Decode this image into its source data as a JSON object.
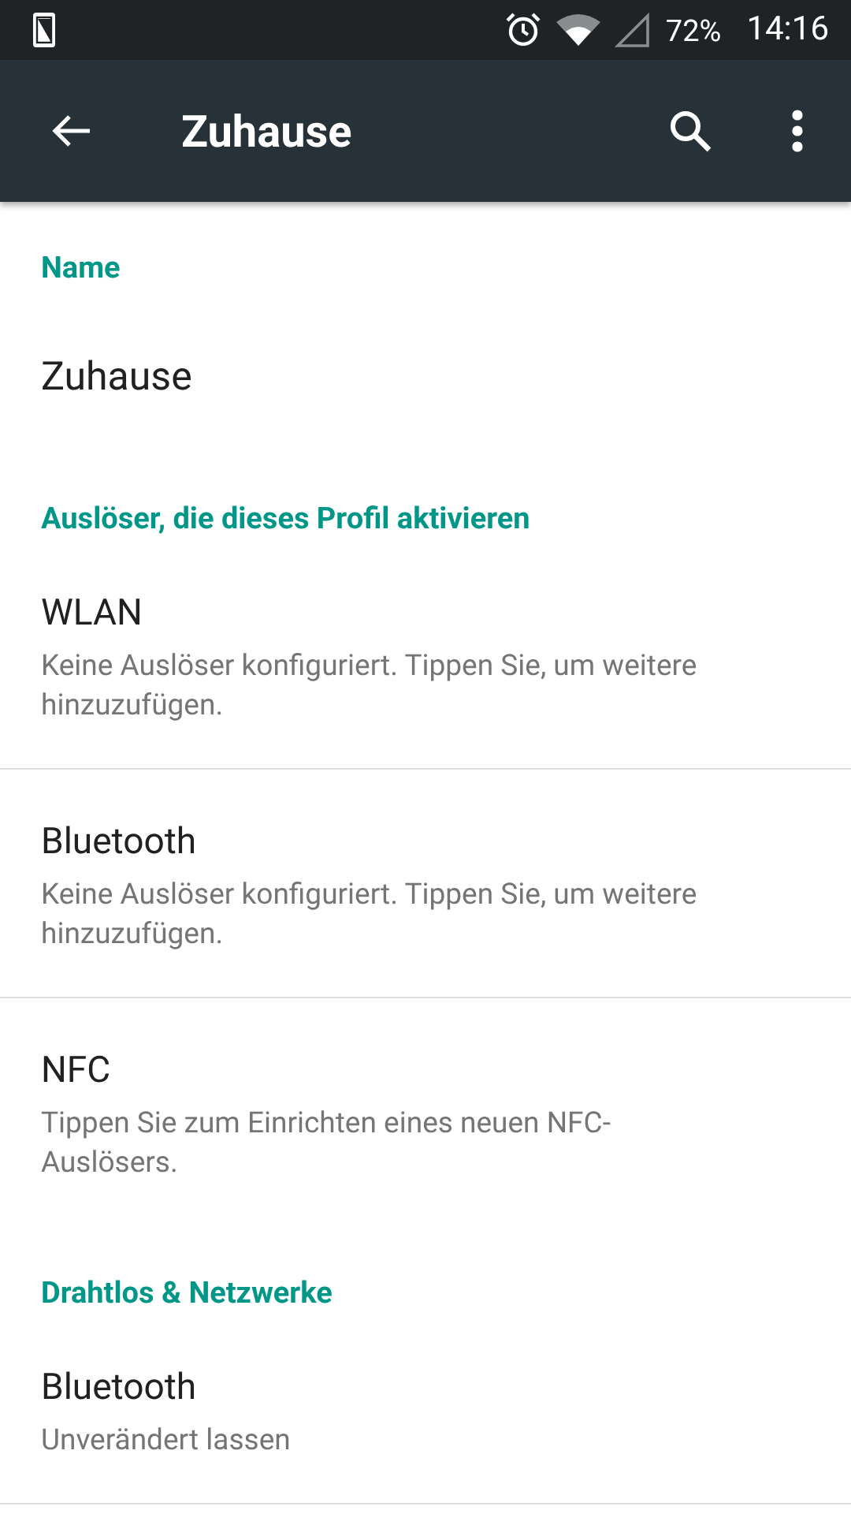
{
  "status_bar": {
    "battery": "72%",
    "time": "14:16"
  },
  "toolbar": {
    "title": "Zuhause"
  },
  "sections": [
    {
      "header": "Name",
      "items": [
        {
          "kind": "value",
          "title": "Zuhause"
        }
      ]
    },
    {
      "header": "Auslöser, die dieses Profil aktivieren",
      "items": [
        {
          "kind": "setting",
          "title": "WLAN",
          "summary": "Keine Auslöser konfiguriert. Tippen Sie, um weitere hinzuzufügen."
        },
        {
          "kind": "setting",
          "title": "Bluetooth",
          "summary": "Keine Auslöser konfiguriert. Tippen Sie, um weitere hinzuzufügen."
        },
        {
          "kind": "setting",
          "title": "NFC",
          "summary": "Tippen Sie zum Einrichten eines neuen NFC-Auslösers."
        }
      ]
    },
    {
      "header": "Drahtlos & Netzwerke",
      "items": [
        {
          "kind": "setting",
          "title": "Bluetooth",
          "summary": "Unverändert lassen"
        }
      ]
    }
  ]
}
